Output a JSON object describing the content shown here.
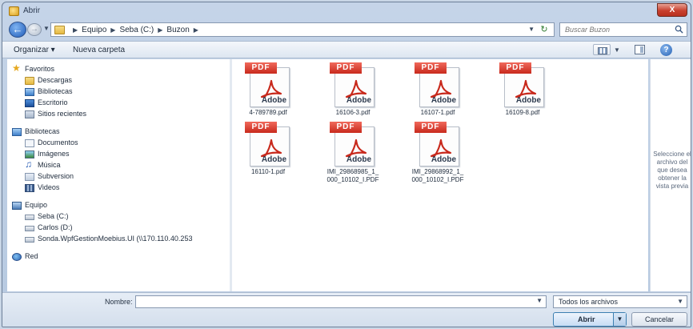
{
  "window": {
    "title": "Abrir",
    "close_label": "X"
  },
  "address": {
    "crumbs": [
      "Equipo",
      "Seba (C:)",
      "Buzon"
    ],
    "search_placeholder": "Buscar Buzon"
  },
  "toolbar": {
    "organize": "Organizar ▾",
    "new_folder": "Nueva carpeta"
  },
  "nav": {
    "favorites": {
      "label": "Favoritos",
      "items": [
        "Descargas",
        "Bibliotecas",
        "Escritorio",
        "Sitios recientes"
      ]
    },
    "libraries": {
      "label": "Bibliotecas",
      "items": [
        "Documentos",
        "Imágenes",
        "Música",
        "Subversion",
        "Videos"
      ]
    },
    "computer": {
      "label": "Equipo",
      "items": [
        "Seba (C:)",
        "Carlos (D:)",
        "Sonda.WpfGestionMoebius.UI (\\\\170.110.40.253"
      ]
    },
    "network": {
      "label": "Red"
    }
  },
  "files": [
    {
      "name": "4-789789.pdf",
      "badge": "PDF",
      "brand": "Adobe"
    },
    {
      "name": "16106-3.pdf",
      "badge": "PDF",
      "brand": "Adobe"
    },
    {
      "name": "16107-1.pdf",
      "badge": "PDF",
      "brand": "Adobe"
    },
    {
      "name": "16109-8.pdf",
      "badge": "PDF",
      "brand": "Adobe"
    },
    {
      "name": "16110-1.pdf",
      "badge": "PDF",
      "brand": "Adobe"
    },
    {
      "name": "IMI_29868985_1_000_10102_I.PDF",
      "badge": "PDF",
      "brand": "Adobe"
    },
    {
      "name": "IMI_29868992_1_000_10102_I.PDF",
      "badge": "PDF",
      "brand": "Adobe"
    }
  ],
  "preview": {
    "message": "Seleccione el archivo del que desea obtener la vista previa"
  },
  "footer": {
    "name_label": "Nombre:",
    "name_value": "",
    "file_type": "Todos los archivos",
    "open_label": "Abrir",
    "cancel_label": "Cancelar"
  },
  "colors": {
    "pdf_red": "#c8291c",
    "selection_blue": "#3c7fb1"
  }
}
